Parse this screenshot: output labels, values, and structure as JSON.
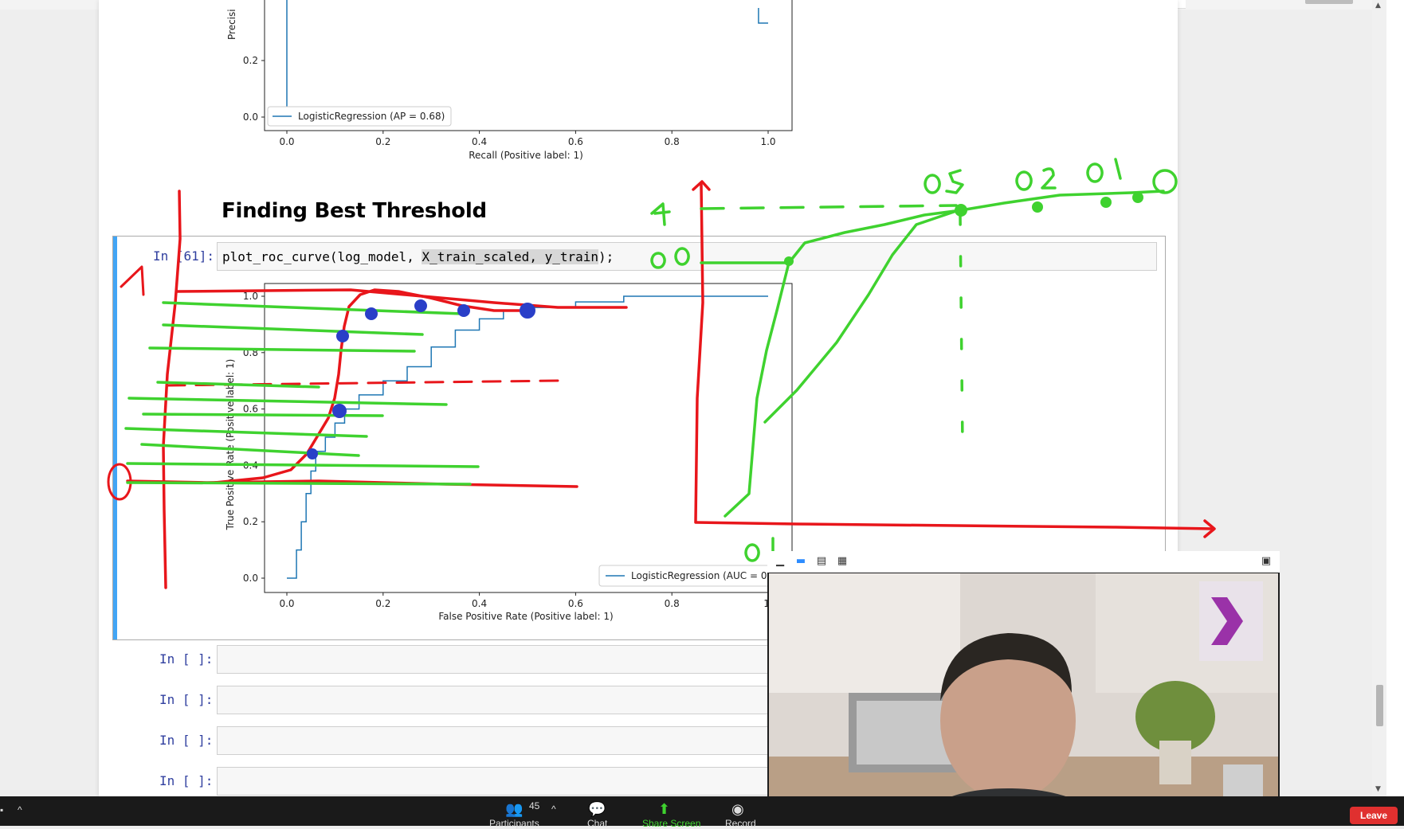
{
  "pr_plot": {
    "ytick_labels": [
      "0.2",
      "0.0"
    ],
    "ylabel_fragment": "Precisi",
    "xtick_labels": [
      "0.0",
      "0.2",
      "0.4",
      "0.6",
      "0.8",
      "1.0"
    ],
    "xlabel": "Recall (Positive label: 1)",
    "legend": "LogisticRegression (AP = 0.68)"
  },
  "heading": "Finding Best Threshold",
  "code_cell": {
    "prompt": "In [61]:",
    "code_pre": "plot_roc_curve(log_model, ",
    "code_hl": "X_train_scaled, y_train",
    "code_post": ");"
  },
  "roc_plot": {
    "ytick_labels": [
      "1.0",
      "0.8",
      "0.6",
      "0.4",
      "0.2",
      "0.0"
    ],
    "ylabel": "True Positive Rate (Positive label: 1)",
    "xtick_labels": [
      "0.0",
      "0.2",
      "0.4",
      "0.6",
      "0.8",
      "1."
    ],
    "xlabel": "False Positive Rate (Positive label: 1)",
    "legend": "LogisticRegression (AUC = 0."
  },
  "chart_data": [
    {
      "type": "line",
      "xlabel": "Recall (Positive label: 1)",
      "ylabel": "Precisi",
      "xlim": [
        0.0,
        1.0
      ],
      "ylim": [
        0.0,
        0.3
      ],
      "series": [
        {
          "name": "LogisticRegression (AP = 0.68)",
          "x": [
            0.0,
            0.0,
            0.98,
            0.99,
            1.0
          ],
          "y": [
            0.3,
            0.0,
            0.3,
            0.33,
            0.33
          ]
        }
      ]
    },
    {
      "type": "line",
      "xlabel": "False Positive Rate (Positive label: 1)",
      "ylabel": "True Positive Rate (Positive label: 1)",
      "xlim": [
        0.0,
        1.0
      ],
      "ylim": [
        0.0,
        1.0
      ],
      "series": [
        {
          "name": "LogisticRegression (AUC = 0.",
          "x": [
            0.0,
            0.02,
            0.03,
            0.04,
            0.05,
            0.06,
            0.08,
            0.1,
            0.12,
            0.15,
            0.2,
            0.25,
            0.3,
            0.35,
            0.4,
            0.45,
            0.5,
            0.6,
            0.7,
            0.8,
            0.9,
            1.0
          ],
          "y": [
            0.0,
            0.1,
            0.2,
            0.3,
            0.38,
            0.45,
            0.5,
            0.55,
            0.6,
            0.65,
            0.7,
            0.75,
            0.82,
            0.88,
            0.92,
            0.95,
            0.96,
            0.98,
            1.0,
            1.0,
            1.0,
            1.0
          ]
        }
      ]
    }
  ],
  "empty_cells": [
    {
      "prompt": "In [ ]:"
    },
    {
      "prompt": "In [ ]:"
    },
    {
      "prompt": "In [ ]:"
    },
    {
      "prompt": "In [ ]:"
    }
  ],
  "taskbar": {
    "participants_count": "45",
    "participants_label": "Participants",
    "chat_label": "Chat",
    "share_label": "Share Screen",
    "record_label": "Record",
    "leave_label": "Leave"
  },
  "annotations": {
    "thresholds": [
      "0,5",
      "0,2",
      "0,1",
      "0"
    ],
    "left_axis_one": "1",
    "right_axis_one": "1",
    "right_axis_point": "0,8",
    "bottom_label": "0,4"
  },
  "colors": {
    "accent": "#42a5f5",
    "prompt": "#303f9f",
    "curve": "#1f77b4",
    "annot_red": "#e8161b",
    "annot_green": "#3fd22f",
    "annot_blue": "#2a3fc8",
    "leave": "#e0302f"
  }
}
